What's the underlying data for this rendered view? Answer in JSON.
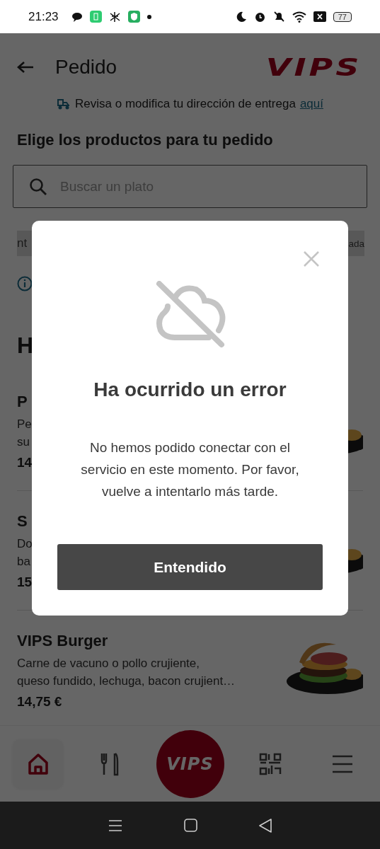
{
  "status_bar": {
    "time": "21:23",
    "battery": "77"
  },
  "header": {
    "title": "Pedido",
    "logo": "VIPS"
  },
  "delivery_notice": {
    "text": "Revisa o modifica tu dirección de entrega",
    "link": "aquí"
  },
  "section_title": "Elige los productos para tu pedido",
  "search": {
    "placeholder": "Buscar un plato"
  },
  "categories": [
    {
      "label": "nt"
    },
    {
      "label": "ada"
    }
  ],
  "category_heading": "H",
  "products": [
    {
      "name": "P",
      "description": [
        "Pe",
        "su"
      ],
      "price": "14"
    },
    {
      "name": "S",
      "description": [
        "Do",
        "ba"
      ],
      "price": "15"
    },
    {
      "name": "VIPS Burger",
      "description": [
        "Carne de vacuno o pollo crujiente,",
        "queso fundido, lechuga, bacon crujient…"
      ],
      "price": "14,75 €"
    }
  ],
  "bottom_nav": [
    {
      "kind": "home",
      "selected": true
    },
    {
      "kind": "menu",
      "selected": false
    },
    {
      "kind": "logo",
      "label": "VIPS",
      "selected": false
    },
    {
      "kind": "qr",
      "selected": false
    },
    {
      "kind": "more",
      "selected": false
    }
  ],
  "dialog": {
    "title": "Ha ocurrido un error",
    "message": "No hemos podido conectar con el servicio en este momento. Por favor, vuelve a intentarlo más tarde.",
    "button": "Entendido"
  }
}
